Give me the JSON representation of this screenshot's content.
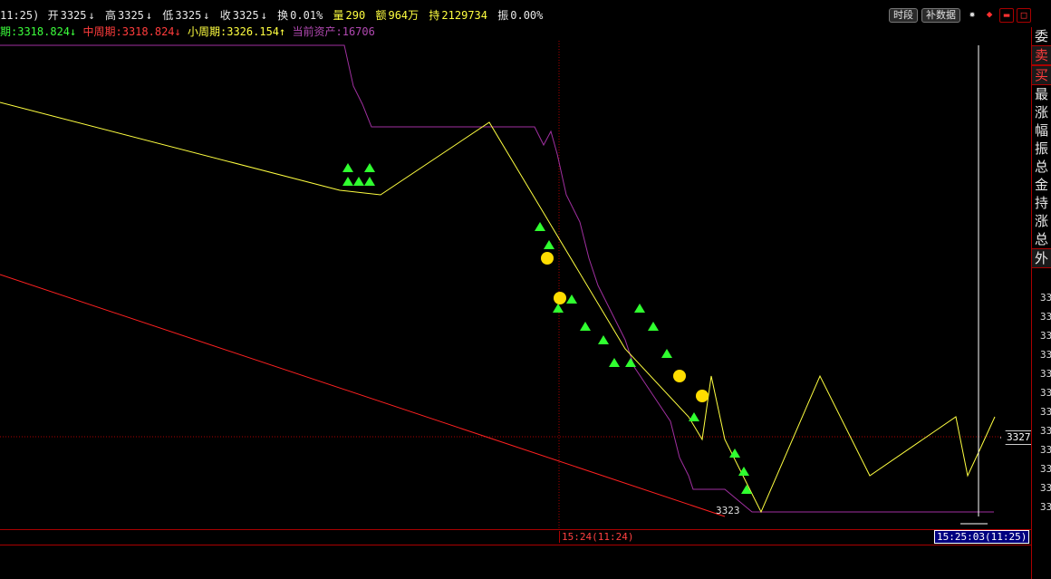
{
  "header": {
    "time": "11:25)",
    "open_label": "开",
    "open_value": "3325",
    "open_arrow": "↓",
    "high_label": "高",
    "high_value": "3325",
    "high_arrow": "↓",
    "low_label": "低",
    "low_value": "3325",
    "low_arrow": "↓",
    "close_label": "收",
    "close_value": "3325",
    "close_arrow": "↓",
    "turnover_label": "换",
    "turnover_value": "0.01%",
    "volume_label": "量",
    "volume_value": "290",
    "amount_label": "额",
    "amount_value": "964万",
    "hold_label": "持",
    "hold_value": "2129734",
    "amplitude_label": "振",
    "amplitude_value": "0.00%"
  },
  "indicators": {
    "big_label": "期:",
    "big_value": "3318.824",
    "big_arrow": "↓",
    "mid_label": "中周期:",
    "mid_value": "3318.824",
    "mid_arrow": "↓",
    "small_label": "小周期:",
    "small_value": "3326.154",
    "small_arrow": "↑",
    "asset_label": "当前资产:",
    "asset_value": "16706"
  },
  "toolbar": {
    "period_button": "时段",
    "supplement_button": "补数据"
  },
  "right_panel": {
    "items": [
      "委",
      "卖",
      "买",
      "最",
      "涨",
      "幅",
      "振",
      "总",
      "金",
      "持",
      "涨",
      "总",
      "外"
    ]
  },
  "axis_labels": [
    "33",
    "33",
    "33",
    "33",
    "33",
    "33",
    "33",
    "33",
    "33",
    "33",
    "33",
    "33"
  ],
  "price_tag": "3327",
  "chart_label": "3323",
  "time_axis": {
    "cursor_time": "15:24(11:24)",
    "current_time": "15:25:03(11:25)"
  },
  "colors": {
    "up": "#ff3c3c",
    "down": "#3cff3c",
    "price": "#ffff40",
    "asset": "#b048b0",
    "grid": "#aa0000"
  }
}
